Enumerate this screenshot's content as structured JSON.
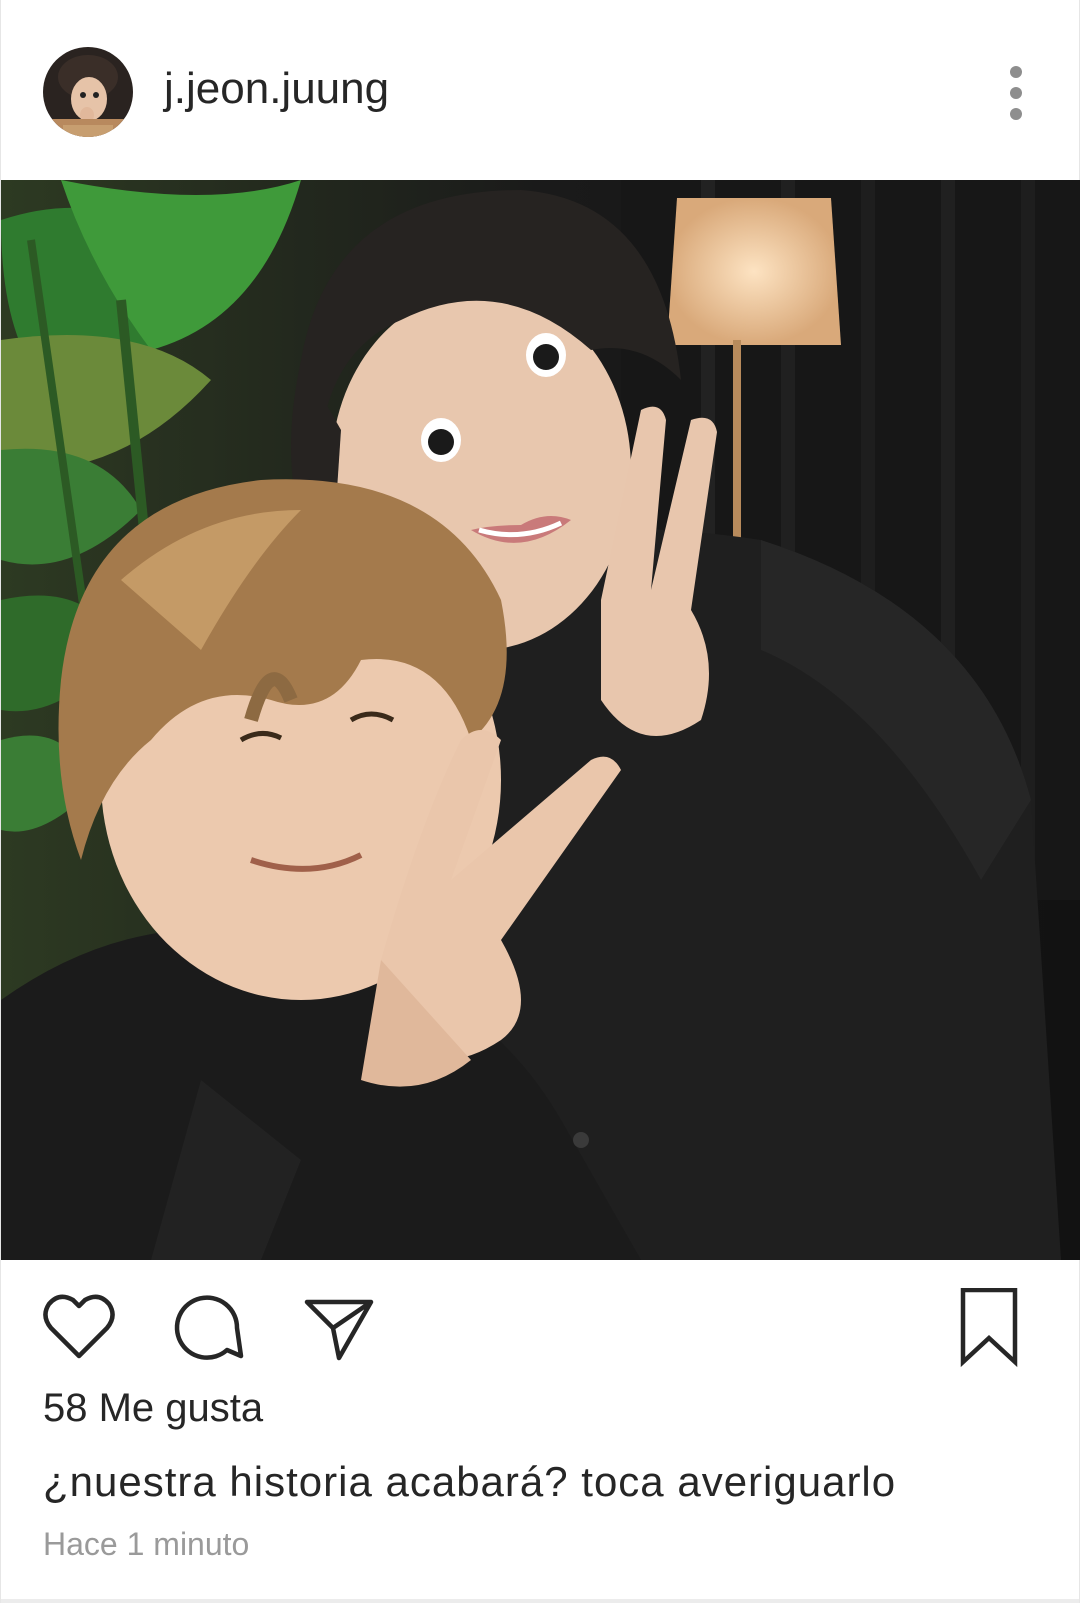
{
  "post": {
    "username": "j.jeon.juung",
    "likes_text": "58 Me gusta",
    "caption": "¿nuestra historia acabará? toca averiguarlo",
    "timestamp": "Hace 1 minuto"
  },
  "icons": {
    "more": "more-vertical-icon",
    "like": "heart-icon",
    "comment": "comment-icon",
    "share": "send-icon",
    "save": "bookmark-icon"
  },
  "colors": {
    "text": "#262626",
    "muted": "#9a9a9a",
    "icon": "#262626",
    "dots": "#8e8e8e"
  }
}
